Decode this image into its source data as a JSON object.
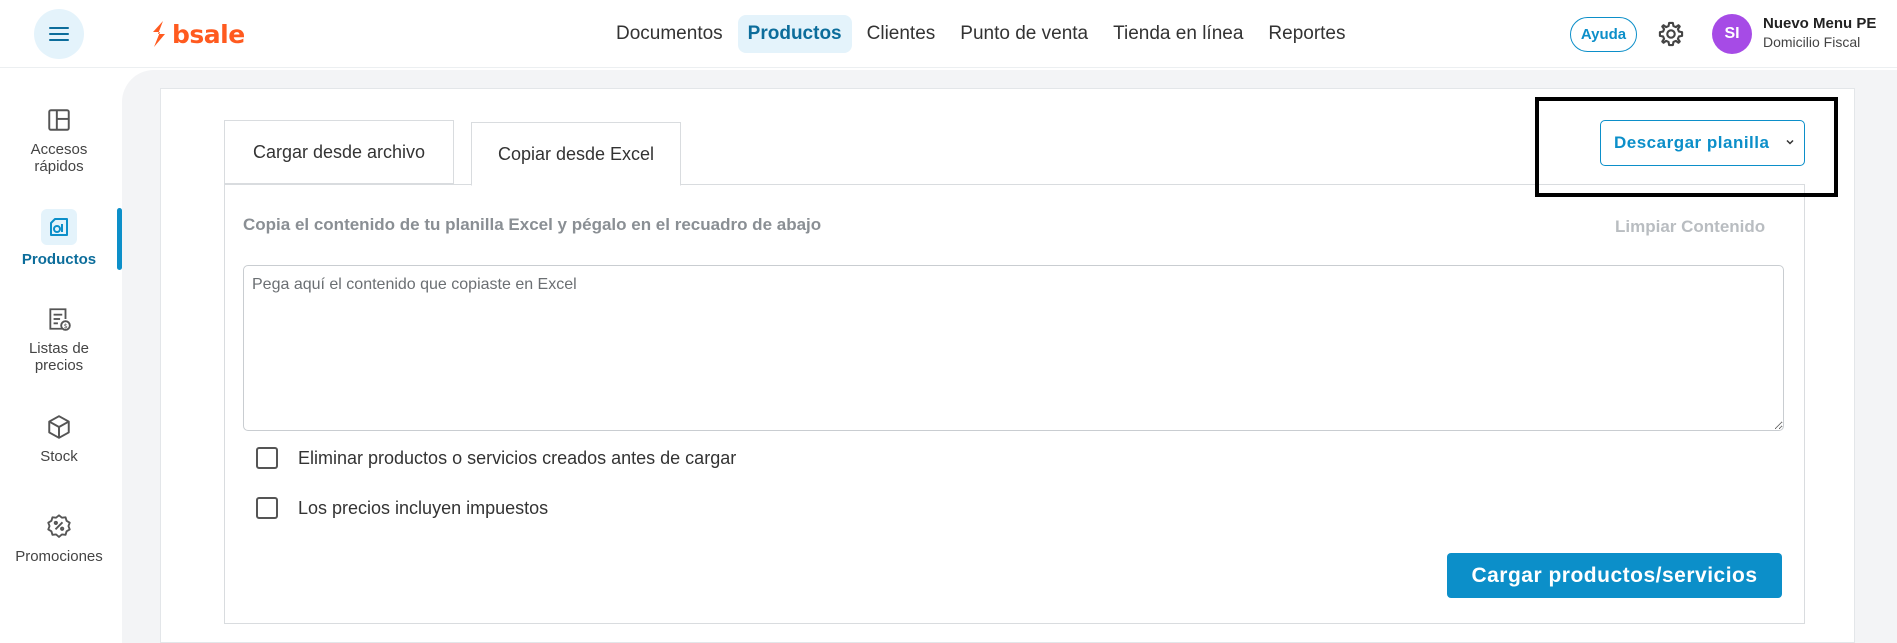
{
  "brand": {
    "name": "bsale",
    "color": "#ff5a1f",
    "accent": "#0c8fc9"
  },
  "header": {
    "menu_icon": "hamburger-menu-icon",
    "nav": [
      {
        "label": "Documentos",
        "active": false
      },
      {
        "label": "Productos",
        "active": true
      },
      {
        "label": "Clientes",
        "active": false
      },
      {
        "label": "Punto de venta",
        "active": false
      },
      {
        "label": "Tienda en línea",
        "active": false
      },
      {
        "label": "Reportes",
        "active": false
      }
    ],
    "help_label": "Ayuda",
    "settings_icon": "gear-icon",
    "avatar_initials": "SI",
    "avatar_color": "#a64be6",
    "account_name": "Nuevo Menu PE",
    "account_sub": "Domicilio Fiscal"
  },
  "sidebar": {
    "items": [
      {
        "label_line1": "Accesos",
        "label_line2": "rápidos",
        "icon": "layout-icon",
        "active": false
      },
      {
        "label_line1": "Productos",
        "label_line2": "",
        "icon": "products-icon",
        "active": true
      },
      {
        "label_line1": "Listas de",
        "label_line2": "precios",
        "icon": "price-list-icon",
        "active": false
      },
      {
        "label_line1": "Stock",
        "label_line2": "",
        "icon": "box-icon",
        "active": false
      },
      {
        "label_line1": "Promociones",
        "label_line2": "",
        "icon": "discount-badge-icon",
        "active": false
      }
    ]
  },
  "main": {
    "tabs": [
      {
        "label": "Cargar desde archivo",
        "active": false
      },
      {
        "label": "Copiar desde Excel",
        "active": true
      }
    ],
    "download_label": "Descargar planilla",
    "instruction": "Copia el contenido de tu planilla Excel y pégalo en el recuadro de abajo",
    "clear_label": "Limpiar Contenido",
    "textarea_placeholder": "Pega aquí el contenido que copiaste en Excel",
    "textarea_value": "",
    "checkboxes": [
      {
        "label": "Eliminar productos o servicios creados antes de cargar",
        "checked": false
      },
      {
        "label": "Los precios incluyen impuestos",
        "checked": false
      }
    ],
    "submit_label": "Cargar productos/servicios"
  }
}
